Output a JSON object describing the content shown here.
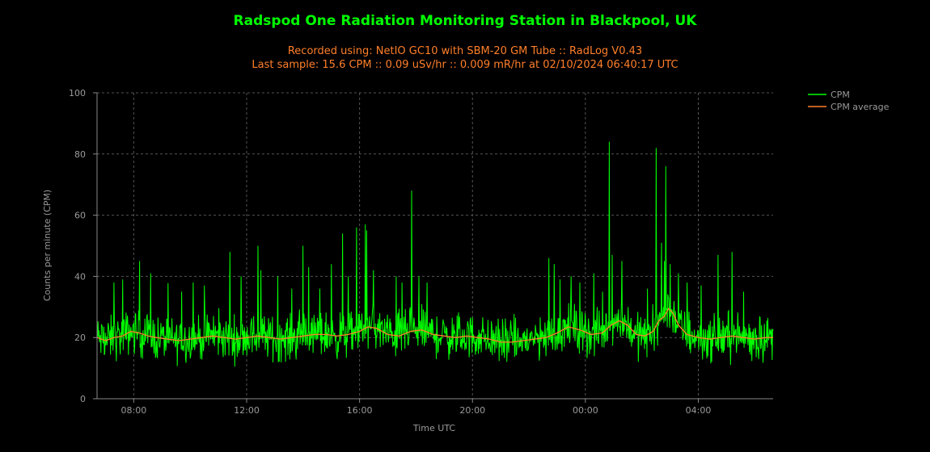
{
  "chart_data": {
    "type": "line",
    "title": "Radspod One Radiation Monitoring Station in Blackpool, UK",
    "subtitle_lines": [
      "Recorded using: NetIO GC10 with SBM-20 GM Tube :: RadLog V0.43",
      "Last sample: 15.6 CPM :: 0.09 uSv/hr :: 0.009 mR/hr at 02/10/2024 06:40:17 UTC"
    ],
    "xlabel": "Time UTC",
    "ylabel": "Counts per minute (CPM)",
    "ylim": [
      0,
      100
    ],
    "yticks": [
      0,
      20,
      40,
      60,
      80,
      100
    ],
    "xlim_hours": [
      6.7,
      30.65
    ],
    "xticks": [
      {
        "h": 8,
        "label": "08:00"
      },
      {
        "h": 12,
        "label": "12:00"
      },
      {
        "h": 16,
        "label": "16:00"
      },
      {
        "h": 20,
        "label": "20:00"
      },
      {
        "h": 24,
        "label": "00:00"
      },
      {
        "h": 28,
        "label": "04:00"
      }
    ],
    "grid": true,
    "legend_position": "top-right",
    "colors": {
      "cpm": "#00ff00",
      "avg": "#ff7f2a",
      "title": "#00ff00",
      "subtitle": "#ff7f2a"
    },
    "series": [
      {
        "name": "CPM",
        "baseline": 20,
        "spikes": [
          [
            7.3,
            38
          ],
          [
            7.6,
            39
          ],
          [
            8.2,
            45
          ],
          [
            8.6,
            41
          ],
          [
            9.7,
            35
          ],
          [
            10.1,
            38
          ],
          [
            10.5,
            37
          ],
          [
            11.4,
            48
          ],
          [
            11.8,
            40
          ],
          [
            12.4,
            50
          ],
          [
            12.5,
            42
          ],
          [
            13.1,
            40
          ],
          [
            13.6,
            36
          ],
          [
            14.0,
            50
          ],
          [
            14.2,
            43
          ],
          [
            14.6,
            36
          ],
          [
            15.0,
            44
          ],
          [
            15.4,
            54
          ],
          [
            15.6,
            40
          ],
          [
            15.9,
            56
          ],
          [
            16.2,
            57
          ],
          [
            16.25,
            55
          ],
          [
            16.5,
            42
          ],
          [
            17.3,
            40
          ],
          [
            17.5,
            38
          ],
          [
            17.85,
            68
          ],
          [
            18.1,
            40
          ],
          [
            18.4,
            38
          ],
          [
            22.7,
            46
          ],
          [
            22.9,
            44
          ],
          [
            23.1,
            39
          ],
          [
            23.5,
            40
          ],
          [
            23.8,
            38
          ],
          [
            24.3,
            41
          ],
          [
            24.6,
            35
          ],
          [
            24.85,
            84
          ],
          [
            24.95,
            47
          ],
          [
            25.3,
            45
          ],
          [
            26.2,
            36
          ],
          [
            26.5,
            82
          ],
          [
            26.7,
            51
          ],
          [
            26.8,
            45
          ],
          [
            26.85,
            76
          ],
          [
            27.0,
            44
          ],
          [
            27.3,
            41
          ],
          [
            27.6,
            38
          ],
          [
            28.1,
            37
          ],
          [
            28.7,
            47
          ],
          [
            29.2,
            48
          ],
          [
            29.6,
            35
          ]
        ]
      },
      {
        "name": "CPM average",
        "points": [
          [
            6.7,
            20
          ],
          [
            7.0,
            19
          ],
          [
            7.3,
            20
          ],
          [
            7.6,
            20.5
          ],
          [
            7.9,
            22
          ],
          [
            8.2,
            21.5
          ],
          [
            8.5,
            20.5
          ],
          [
            8.8,
            20
          ],
          [
            9.2,
            19.5
          ],
          [
            9.6,
            19
          ],
          [
            10.0,
            19.5
          ],
          [
            10.4,
            20
          ],
          [
            10.8,
            20.5
          ],
          [
            11.2,
            20
          ],
          [
            11.6,
            19.5
          ],
          [
            12.0,
            20
          ],
          [
            12.4,
            20.5
          ],
          [
            12.8,
            20
          ],
          [
            13.2,
            19.5
          ],
          [
            13.6,
            20
          ],
          [
            14.0,
            20.5
          ],
          [
            14.4,
            21
          ],
          [
            14.8,
            21
          ],
          [
            15.2,
            20.5
          ],
          [
            15.6,
            21
          ],
          [
            16.0,
            22
          ],
          [
            16.3,
            23.5
          ],
          [
            16.6,
            23
          ],
          [
            17.0,
            21
          ],
          [
            17.4,
            20.5
          ],
          [
            17.8,
            22
          ],
          [
            18.2,
            22.5
          ],
          [
            18.6,
            21
          ],
          [
            19.0,
            20.5
          ],
          [
            19.4,
            20
          ],
          [
            19.8,
            20.5
          ],
          [
            20.2,
            20
          ],
          [
            20.6,
            19.5
          ],
          [
            21.0,
            18.5
          ],
          [
            21.4,
            18.5
          ],
          [
            21.8,
            19
          ],
          [
            22.2,
            19.5
          ],
          [
            22.6,
            20
          ],
          [
            23.0,
            21.5
          ],
          [
            23.4,
            23.5
          ],
          [
            23.8,
            22.5
          ],
          [
            24.2,
            21
          ],
          [
            24.6,
            21.5
          ],
          [
            24.9,
            24
          ],
          [
            25.2,
            25.5
          ],
          [
            25.5,
            24
          ],
          [
            25.8,
            21
          ],
          [
            26.1,
            20.5
          ],
          [
            26.4,
            22
          ],
          [
            26.6,
            25.5
          ],
          [
            26.8,
            27
          ],
          [
            26.95,
            29.5
          ],
          [
            27.1,
            28
          ],
          [
            27.3,
            24
          ],
          [
            27.6,
            21
          ],
          [
            28.0,
            20
          ],
          [
            28.4,
            19.5
          ],
          [
            28.8,
            20
          ],
          [
            29.2,
            20.5
          ],
          [
            29.6,
            20
          ],
          [
            30.0,
            19.5
          ],
          [
            30.4,
            20
          ],
          [
            30.65,
            20
          ]
        ]
      }
    ]
  }
}
